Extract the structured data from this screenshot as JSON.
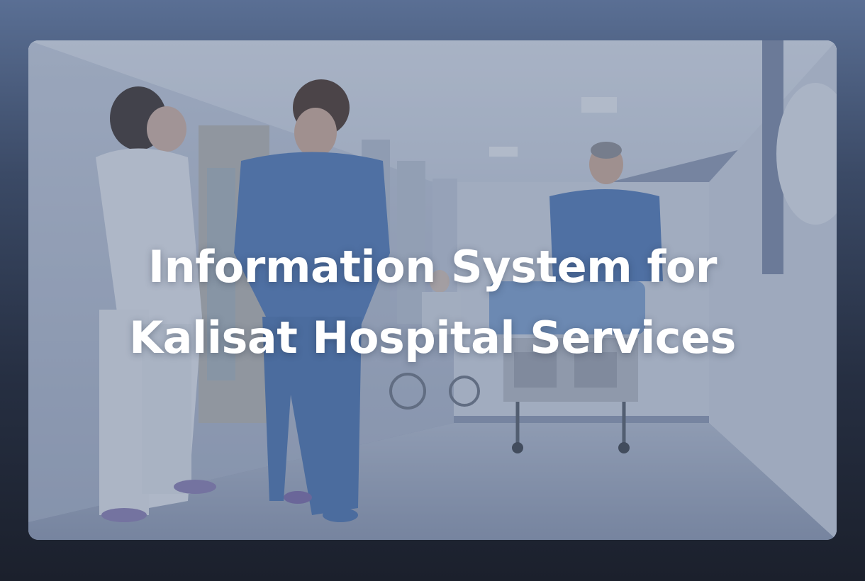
{
  "hero": {
    "title_line_1": "Information System for",
    "title_line_2": "Kalisat Hospital Services",
    "image_description": "hospital-corridor-photo"
  }
}
